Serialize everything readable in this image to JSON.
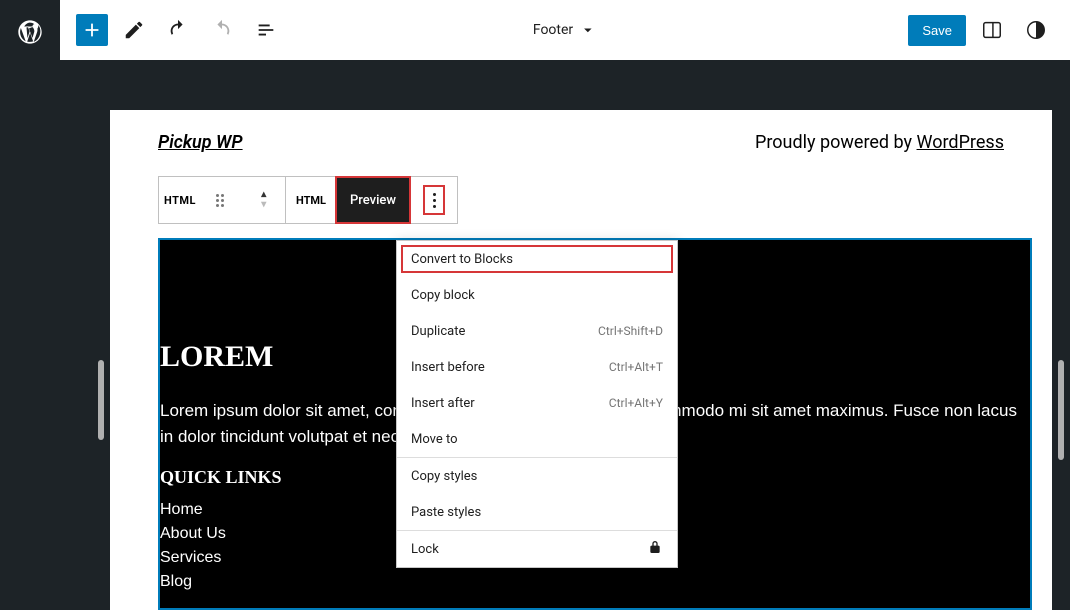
{
  "topbar": {
    "template_name": "Footer",
    "save_label": "Save"
  },
  "footer": {
    "site_title": "Pickup WP",
    "powered_prefix": "Proudly powered by ",
    "powered_link": "WordPress"
  },
  "block_toolbar": {
    "type_label": "HTML",
    "html_tab": "HTML",
    "preview_tab": "Preview"
  },
  "preview_content": {
    "heading": "LOREM",
    "paragraph": "Lorem ipsum dolor sit amet, consectetur adipiscing elit. Nunc vel commodo mi sit amet maximus. Fusce non lacus in dolor tincidunt volutpat et nec tortor.",
    "quick_links_heading": "QUICK LINKS",
    "links": [
      "Home",
      "About Us",
      "Services",
      "Blog"
    ]
  },
  "dropdown": {
    "items": [
      {
        "label": "Convert to Blocks",
        "shortcut": "",
        "highlighted": true
      },
      {
        "label": "Copy block",
        "shortcut": ""
      },
      {
        "label": "Duplicate",
        "shortcut": "Ctrl+Shift+D"
      },
      {
        "label": "Insert before",
        "shortcut": "Ctrl+Alt+T"
      },
      {
        "label": "Insert after",
        "shortcut": "Ctrl+Alt+Y"
      },
      {
        "label": "Move to",
        "shortcut": ""
      }
    ],
    "group2": [
      {
        "label": "Copy styles",
        "shortcut": ""
      },
      {
        "label": "Paste styles",
        "shortcut": ""
      }
    ],
    "group3": [
      {
        "label": "Lock",
        "shortcut": "",
        "lock_icon": true
      }
    ]
  }
}
